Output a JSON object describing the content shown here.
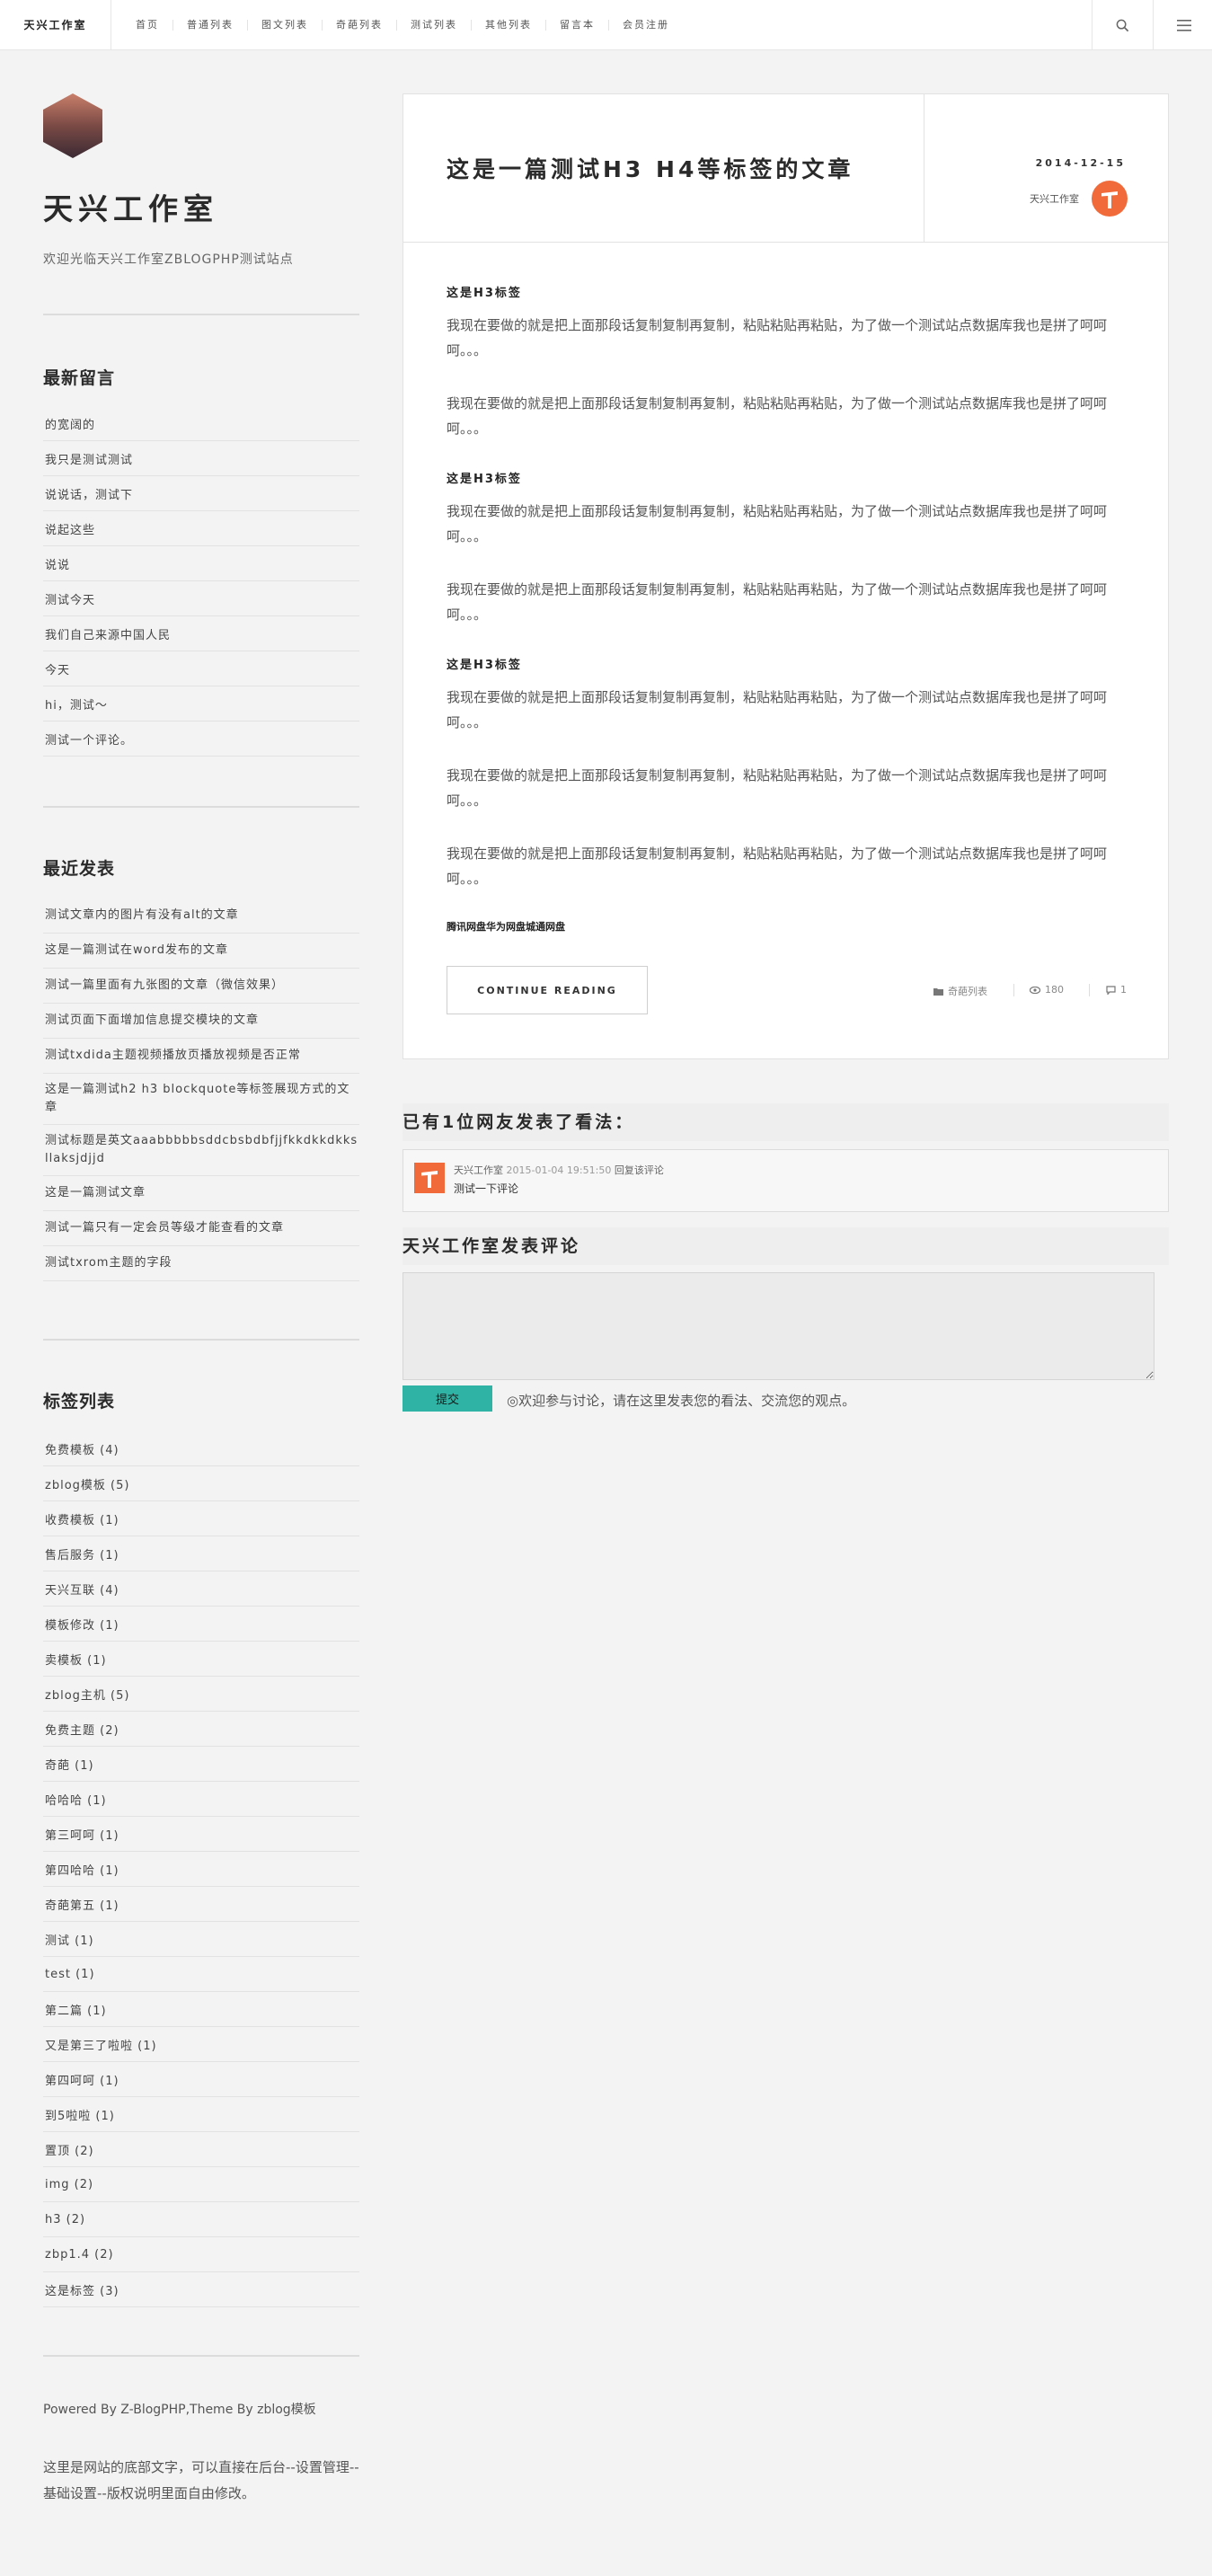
{
  "header": {
    "brand": "天兴工作室",
    "nav": [
      "首页",
      "普通列表",
      "图文列表",
      "奇葩列表",
      "测试列表",
      "其他列表",
      "留言本",
      "会员注册"
    ]
  },
  "sidebar": {
    "site_title": "天兴工作室",
    "site_desc": "欢迎光临天兴工作室ZBLOGPHP测试站点",
    "recent_comments": {
      "title": "最新留言",
      "items": [
        "的宽阔的",
        "我只是测试测试",
        "说说话，测试下",
        "说起这些",
        "说说",
        "测试今天",
        "我们自己来源中国人民",
        "今天",
        "hi，测试～",
        "测试一个评论。"
      ]
    },
    "recent_posts": {
      "title": "最近发表",
      "items": [
        "测试文章内的图片有没有alt的文章",
        "这是一篇测试在word发布的文章",
        "测试一篇里面有九张图的文章（微信效果）",
        "测试页面下面增加信息提交模块的文章",
        "测试txdida主题视频播放页播放视频是否正常",
        "这是一篇测试h2 h3 blockquote等标签展现方式的文章",
        "测试标题是英文aaabbbbbsddcbsbdbfjjfkkdkkdkksllaksjdjjd",
        "这是一篇测试文章",
        "测试一篇只有一定会员等级才能查看的文章",
        "测试txrom主题的字段"
      ]
    },
    "tags": {
      "title": "标签列表",
      "items": [
        "免费模板 (4)",
        "zblog模板 (5)",
        "收费模板 (1)",
        "售后服务 (1)",
        "天兴互联 (4)",
        "模板修改 (1)",
        "卖模板 (1)",
        "zblog主机 (5)",
        "免费主题 (2)",
        "奇葩 (1)",
        "哈哈哈 (1)",
        "第三呵呵 (1)",
        "第四哈哈 (1)",
        "奇葩第五 (1)",
        "测试 (1)",
        "test (1)",
        "第二篇 (1)",
        "又是第三了啦啦 (1)",
        "第四呵呵 (1)",
        "到5啦啦 (1)",
        "置顶 (2)",
        "img (2)",
        "h3 (2)",
        "zbp1.4 (2)",
        "这是标签 (3)"
      ]
    }
  },
  "footer": {
    "powered": "Powered By Z-BlogPHP,Theme By zblog模板",
    "note": "这里是网站的底部文字，可以直接在后台--设置管理--基础设置--版权说明里面自由修改。"
  },
  "article": {
    "title": "这是一篇测试H3 H4等标签的文章",
    "date": "2014-12-15",
    "author": "天兴工作室",
    "blocks": [
      {
        "type": "h3",
        "text": "这是H3标签"
      },
      {
        "type": "p",
        "text": "我现在要做的就是把上面那段话复制复制再复制，粘贴粘贴再粘贴，为了做一个测试站点数据库我也是拼了呵呵呵。。。"
      },
      {
        "type": "p",
        "text": "我现在要做的就是把上面那段话复制复制再复制，粘贴粘贴再粘贴，为了做一个测试站点数据库我也是拼了呵呵呵。。。"
      },
      {
        "type": "h3",
        "text": "这是H3标签"
      },
      {
        "type": "p",
        "text": "我现在要做的就是把上面那段话复制复制再复制，粘贴粘贴再粘贴，为了做一个测试站点数据库我也是拼了呵呵呵。。。"
      },
      {
        "type": "p",
        "text": "我现在要做的就是把上面那段话复制复制再复制，粘贴粘贴再粘贴，为了做一个测试站点数据库我也是拼了呵呵呵。。。"
      },
      {
        "type": "h3",
        "text": "这是H3标签"
      },
      {
        "type": "p",
        "text": "我现在要做的就是把上面那段话复制复制再复制，粘贴粘贴再粘贴，为了做一个测试站点数据库我也是拼了呵呵呵。。。"
      },
      {
        "type": "p",
        "text": "我现在要做的就是把上面那段话复制复制再复制，粘贴粘贴再粘贴，为了做一个测试站点数据库我也是拼了呵呵呵。。。"
      },
      {
        "type": "p",
        "text": "我现在要做的就是把上面那段话复制复制再复制，粘贴粘贴再粘贴，为了做一个测试站点数据库我也是拼了呵呵呵。。。"
      },
      {
        "type": "h4",
        "text": "腾讯网盘华为网盘城通网盘"
      }
    ],
    "read_more": "CONTINUE READING",
    "category": "奇葩列表",
    "views": "180",
    "comments": "1"
  },
  "comments": {
    "heading": "已有1位网友发表了看法：",
    "list": [
      {
        "author": "天兴工作室",
        "time": "2015-01-04 19:51:50",
        "reply": "回复该评论",
        "text": "测试一下评论"
      }
    ]
  },
  "comment_form": {
    "heading": "天兴工作室发表评论",
    "submit": "提交",
    "hint": "◎欢迎参与讨论，请在这里发表您的看法、交流您的观点。"
  },
  "colors": {
    "accent": "#f06a3a",
    "submit": "#2fb3a5"
  }
}
